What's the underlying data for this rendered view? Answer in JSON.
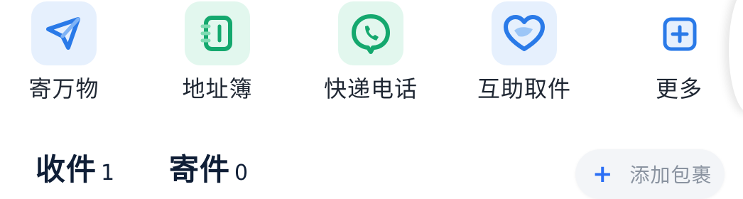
{
  "quick_actions": [
    {
      "label": "寄万物",
      "icon": "paper-plane-icon"
    },
    {
      "label": "地址簿",
      "icon": "address-book-icon"
    },
    {
      "label": "快递电话",
      "icon": "phone-chat-icon"
    },
    {
      "label": "互助取件",
      "icon": "heart-hands-icon"
    },
    {
      "label": "更多",
      "icon": "plus-square-icon"
    }
  ],
  "tabs": [
    {
      "label": "收件",
      "count": "1"
    },
    {
      "label": "寄件",
      "count": "0"
    }
  ],
  "add_package": {
    "label": "添加包裹",
    "icon": "plus-icon"
  },
  "colors": {
    "accent_blue": "#2a6ef5",
    "accent_green": "#1ab07a",
    "text_dark": "#0f1e36"
  }
}
